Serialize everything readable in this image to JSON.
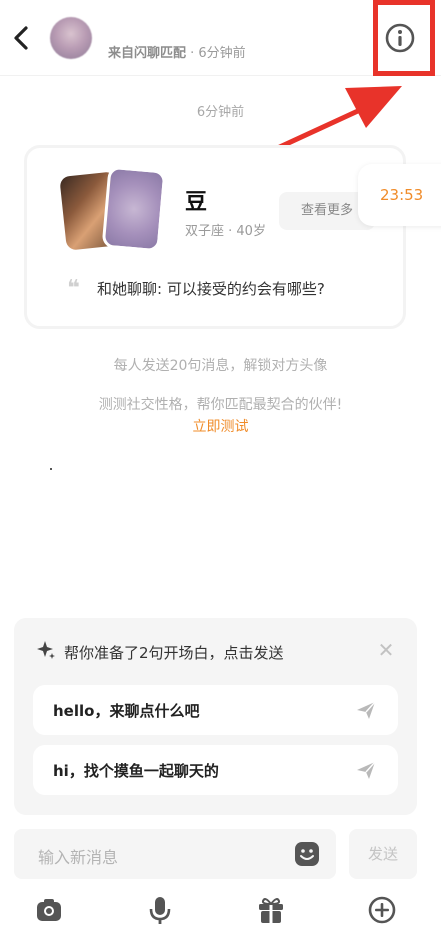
{
  "header": {
    "source_label": "来自闪聊匹配",
    "source_time": " · 6分钟前"
  },
  "chat": {
    "timestamp": "6分钟前"
  },
  "profile_card": {
    "name": "豆",
    "meta": "双子座 · 40岁",
    "see_more": "查看更多",
    "question": "和她聊聊: 可以接受的约会有哪些?"
  },
  "time_pill": "23:53",
  "system": {
    "unlock_hint": "每人发送20句消息，解锁对方头像",
    "test_hint": "测测社交性格，帮你匹配最契合的伙伴!",
    "test_link": "立即测试"
  },
  "opener": {
    "title": "帮你准备了2句开场白，点击发送",
    "items": [
      {
        "text": "hello，来聊点什么吧"
      },
      {
        "text": "hi，找个摸鱼一起聊天的"
      }
    ]
  },
  "composer": {
    "placeholder": "输入新消息",
    "send_label": "发送"
  },
  "colors": {
    "accent": "#f08c2a",
    "annotation": "#e8332a"
  }
}
